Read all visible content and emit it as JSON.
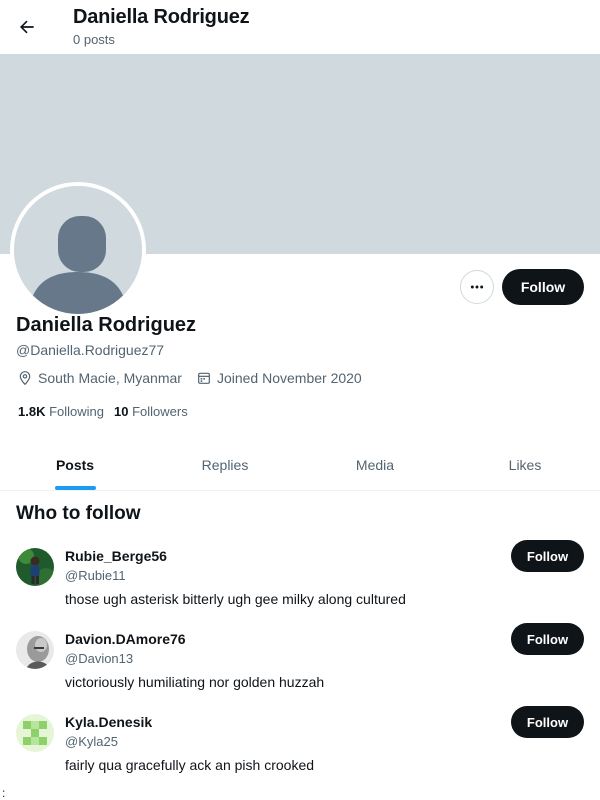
{
  "header": {
    "title": "Daniella Rodriguez",
    "posts_count": "0 posts",
    "back_icon": "arrow-left-icon"
  },
  "colors": {
    "banner": "#cfd9de",
    "accent": "#1d9bf0",
    "button_bg": "#0f1419",
    "muted_text": "#536471"
  },
  "profile": {
    "name": "Daniella Rodriguez",
    "handle": "@Daniella.Rodriguez77",
    "location": "South Macie, Myanmar",
    "joined": "Joined November 2020",
    "following_count": "1.8K",
    "following_label": "Following",
    "followers_count": "10",
    "followers_label": "Followers",
    "follow_label": "Follow",
    "more_icon": "more-horizontal-icon"
  },
  "tabs": [
    {
      "label": "Posts",
      "active": true
    },
    {
      "label": "Replies",
      "active": false
    },
    {
      "label": "Media",
      "active": false
    },
    {
      "label": "Likes",
      "active": false
    }
  ],
  "who_to_follow": {
    "title": "Who to follow",
    "follow_label": "Follow",
    "suggestions": [
      {
        "name": "Rubie_Berge56",
        "handle": "@Rubie11",
        "bio": "those ugh asterisk bitterly ugh gee milky along cultured",
        "avatar": "photo-person-green"
      },
      {
        "name": "Davion.DAmore76",
        "handle": "@Davion13",
        "bio": "victoriously humiliating nor golden huzzah",
        "avatar": "photo-person-bw"
      },
      {
        "name": "Kyla.Denesik",
        "handle": "@Kyla25",
        "bio": "fairly qua gracefully ack an pish crooked",
        "avatar": "identicon-green"
      }
    ]
  },
  "stray_text": ":"
}
